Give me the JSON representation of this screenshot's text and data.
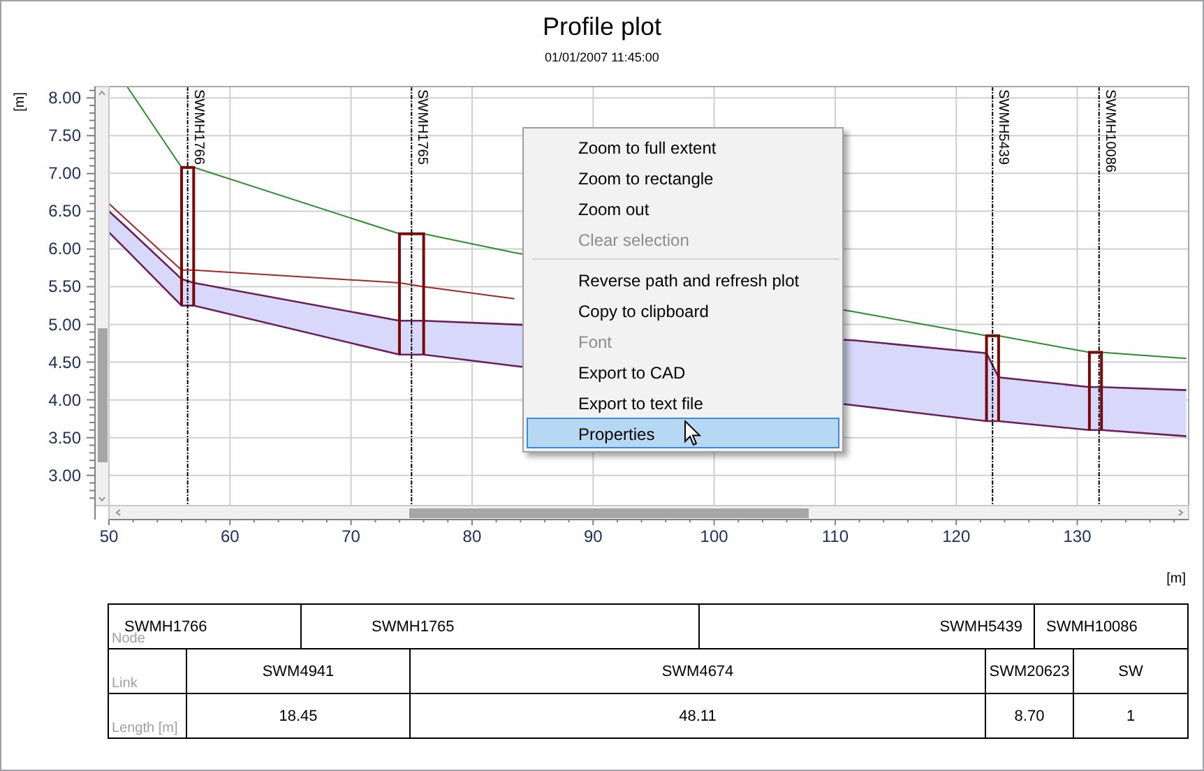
{
  "title": "Profile plot",
  "subtitle": "01/01/2007 11:45:00",
  "chart": {
    "chart_data": {
      "type": "line",
      "xlabel": "[m]",
      "ylabel": "[m]",
      "grid": true,
      "x": [
        50,
        51.5,
        56,
        57,
        74,
        76,
        83.5,
        111.5,
        122.5,
        123.5,
        131,
        132,
        139
      ],
      "series": [
        {
          "color": "#2e8b2e",
          "values": [
            null,
            8.15,
            7.08,
            7.08,
            6.2,
            6.2,
            5.95,
            5.17,
            4.85,
            4.85,
            4.63,
            4.63,
            4.55
          ]
        },
        {
          "color": "#a02828",
          "values": [
            6.6,
            6.38,
            5.72,
            5.72,
            5.55,
            5.5,
            5.34,
            null,
            null,
            null,
            null,
            null,
            null
          ]
        },
        {
          "color": "#6a1f5a",
          "values": [
            6.5,
            6.28,
            5.6,
            5.55,
            5.05,
            5.05,
            5.0,
            4.79,
            4.62,
            4.3,
            4.17,
            4.17,
            4.13
          ]
        },
        {
          "color": "#6a1f5a",
          "values": [
            6.22,
            5.98,
            5.25,
            5.25,
            4.6,
            4.6,
            4.45,
            3.93,
            3.72,
            3.72,
            3.6,
            3.6,
            3.52
          ]
        }
      ],
      "xlim": [
        50,
        139.2
      ],
      "ylim": [
        2.6,
        8.15
      ],
      "xticks": [
        50,
        60,
        70,
        80,
        90,
        100,
        110,
        120,
        130
      ],
      "yticks": [
        {
          "value": 3,
          "label": "3.00"
        },
        {
          "value": 3.5,
          "label": "3.50"
        },
        {
          "value": 4,
          "label": "4.00"
        },
        {
          "value": 4.5,
          "label": "4.50"
        },
        {
          "value": 5,
          "label": "5.00"
        },
        {
          "value": 5.5,
          "label": "5.50"
        },
        {
          "value": 6,
          "label": "6.00"
        },
        {
          "value": 6.5,
          "label": "6.50"
        },
        {
          "value": 7,
          "label": "7.00"
        },
        {
          "value": 7.5,
          "label": "7.50"
        },
        {
          "value": 8,
          "label": "8.00"
        }
      ],
      "ref_lines": [
        {
          "axis": "x",
          "value": 56.5,
          "label": "SWMH1766"
        },
        {
          "axis": "x",
          "value": 75,
          "label": "SWMH1765"
        },
        {
          "axis": "x",
          "value": 123,
          "label": "SWMH5439"
        },
        {
          "axis": "x",
          "value": 131.8,
          "label": "SWMH10086"
        }
      ]
    }
  },
  "context_menu": {
    "items": [
      {
        "kind": "item",
        "label": "Zoom to full extent",
        "disabled": false,
        "selected": false
      },
      {
        "kind": "item",
        "label": "Zoom to rectangle",
        "disabled": false,
        "selected": false
      },
      {
        "kind": "item",
        "label": "Zoom out",
        "disabled": false,
        "selected": false
      },
      {
        "kind": "item",
        "label": "Clear selection",
        "disabled": true,
        "selected": false
      },
      {
        "kind": "separator"
      },
      {
        "kind": "item",
        "label": "Reverse path and refresh plot",
        "disabled": false,
        "selected": false
      },
      {
        "kind": "item",
        "label": "Copy to clipboard",
        "disabled": false,
        "selected": false
      },
      {
        "kind": "item",
        "label": "Font",
        "disabled": true,
        "selected": false
      },
      {
        "kind": "item",
        "label": "Export to CAD",
        "disabled": false,
        "selected": false
      },
      {
        "kind": "item",
        "label": "Export to text file",
        "disabled": false,
        "selected": false
      },
      {
        "kind": "item",
        "label": "Properties",
        "disabled": false,
        "selected": true
      }
    ]
  },
  "table": {
    "rows": [
      {
        "label": "Node",
        "cells": [
          "SWMH1766",
          "SWMH1765",
          "SWMH5439",
          "SWMH10086"
        ]
      },
      {
        "label": "Link",
        "cells": [
          "SWM4941",
          "SWM4674",
          "SWM20623",
          "SW"
        ]
      },
      {
        "label": "Length [m]",
        "cells": [
          "18.45",
          "48.11",
          "8.70",
          "1"
        ]
      }
    ]
  }
}
